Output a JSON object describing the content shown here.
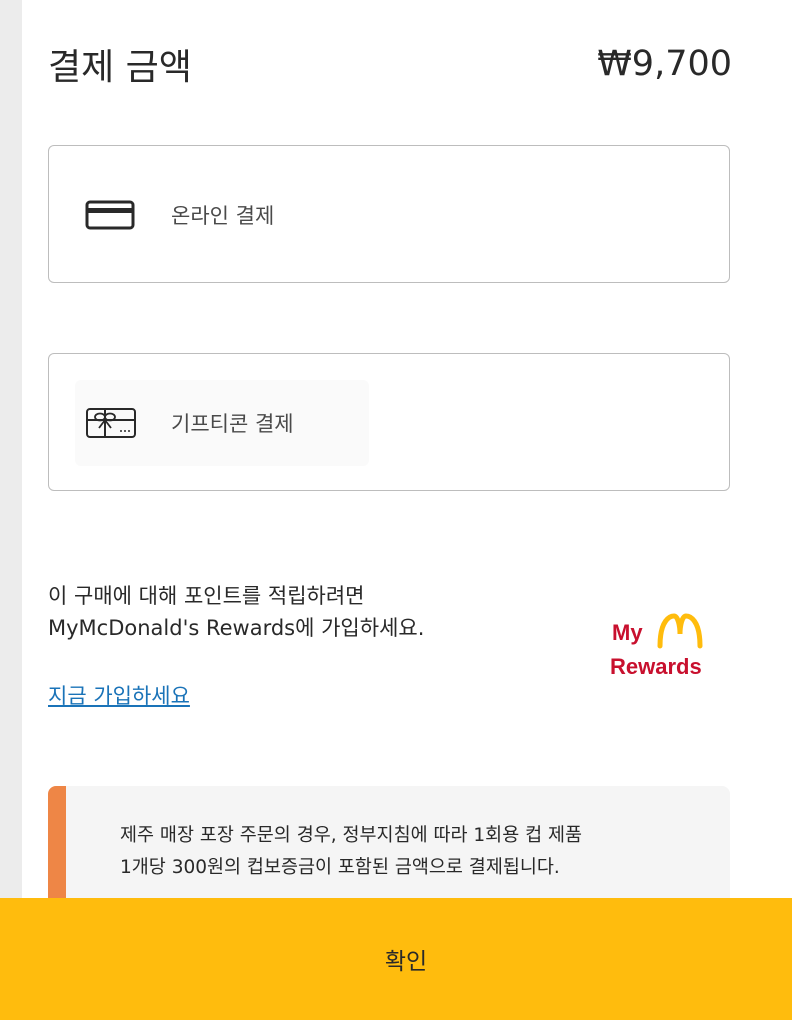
{
  "payment": {
    "amount_label": "결제 금액",
    "amount_value": "₩9,700"
  },
  "options": {
    "online": {
      "label": "온라인 결제",
      "icon": "credit-card-icon"
    },
    "gift": {
      "label": "기프티콘 결제",
      "icon": "gift-card-icon"
    }
  },
  "rewards": {
    "line1": "이 구매에 대해 포인트를 적립하려면",
    "line2": "MyMcDonald's Rewards에 가입하세요.",
    "join_label": "지금 가입하세요",
    "logo_text_top": "My",
    "logo_text_bottom": "Rewards"
  },
  "notice": {
    "line1": "제주 매장 포장 주문의 경우, 정부지침에 따라 1회용 컵 제품",
    "line2": "1개당 300원의 컵보증금이 포함된 금액으로 결제됩니다."
  },
  "confirm": {
    "label": "확인"
  },
  "colors": {
    "accent_yellow": "#ffbc0d",
    "notice_orange": "#ee8646",
    "link_blue": "#1a73b8",
    "brand_red": "#c8102e"
  }
}
